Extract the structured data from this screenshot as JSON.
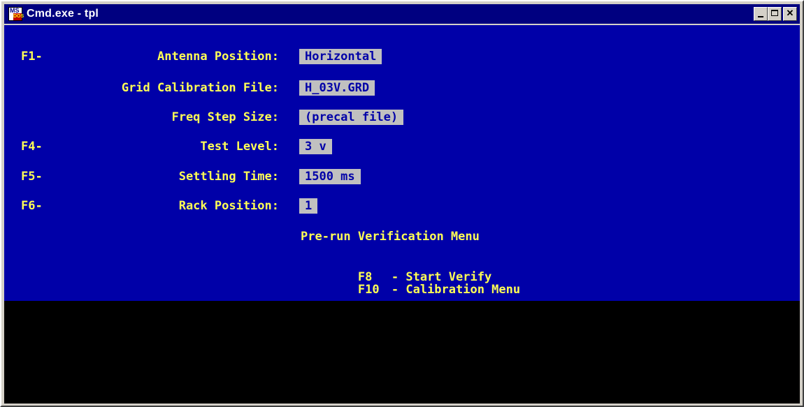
{
  "window": {
    "title": "Cmd.exe - tpl",
    "icon": "ms-dos-icon",
    "caption_buttons": [
      "minimize",
      "maximize",
      "close"
    ]
  },
  "colors": {
    "console_bg": "#0000a8",
    "text": "#ffff55",
    "field_bg": "#c0c0c0",
    "field_text": "#0000a8",
    "lower_bg": "#000000",
    "titlebar": "#000080"
  },
  "fields": [
    {
      "key": "F1-",
      "label": "Antenna Position:",
      "value": "Horizontal"
    },
    {
      "key": "",
      "label": "Grid Calibration File:",
      "value": "H_03V.GRD"
    },
    {
      "key": "",
      "label": "Freq Step Size:",
      "value": "(precal file)"
    },
    {
      "key": "F4-",
      "label": "Test Level:",
      "value": "3 v"
    },
    {
      "key": "F5-",
      "label": "Settling Time:",
      "value": "1500 ms"
    },
    {
      "key": "F6-",
      "label": "Rack Position:",
      "value": "1"
    }
  ],
  "menu": {
    "title": "Pre-run Verification Menu",
    "items": [
      {
        "key": "F8",
        "label": "- Start Verify"
      },
      {
        "key": "F10",
        "label": "- Calibration Menu"
      }
    ]
  }
}
